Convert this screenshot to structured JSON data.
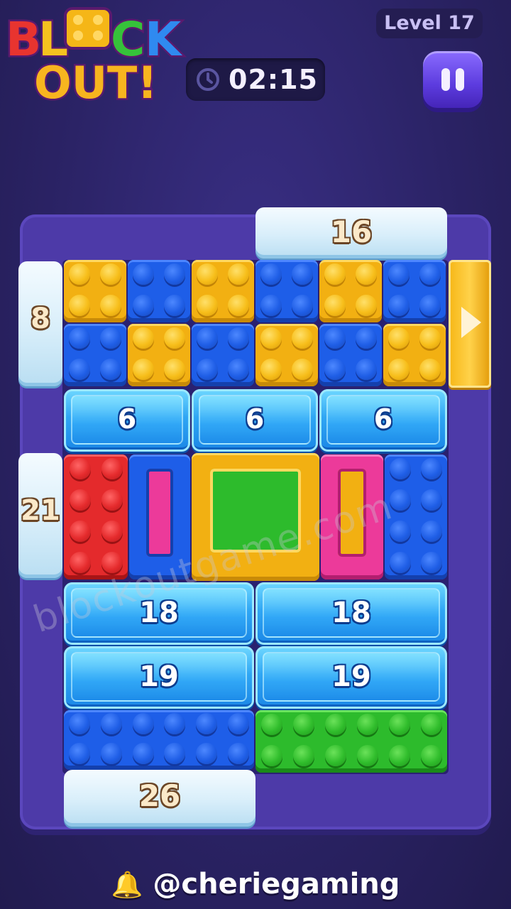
{
  "header": {
    "logo_line1": "BLOCK",
    "logo_line2": "OUT!",
    "timer": "02:15",
    "level_label": "Level 17",
    "pause_icon": "pause-icon",
    "clock_icon": "clock-icon"
  },
  "gates": {
    "top": "16",
    "left_upper": "8",
    "left_lower": "21",
    "bottom": "26"
  },
  "ice": {
    "row1": [
      "6",
      "6",
      "6"
    ],
    "row2": [
      "18",
      "18"
    ],
    "row3": [
      "19",
      "19"
    ]
  },
  "colors": {
    "yellow": "#f2b012",
    "blue": "#1e5ee8",
    "red": "#e42a2c",
    "green": "#2dbb2c",
    "pink": "#ec3a9a",
    "ice": "#2fa6f4",
    "board": "#4d3aa8"
  },
  "watermark": "blockoutgame.com",
  "footer": {
    "bell_icon": "bell-icon",
    "handle": "@cheriegaming"
  }
}
